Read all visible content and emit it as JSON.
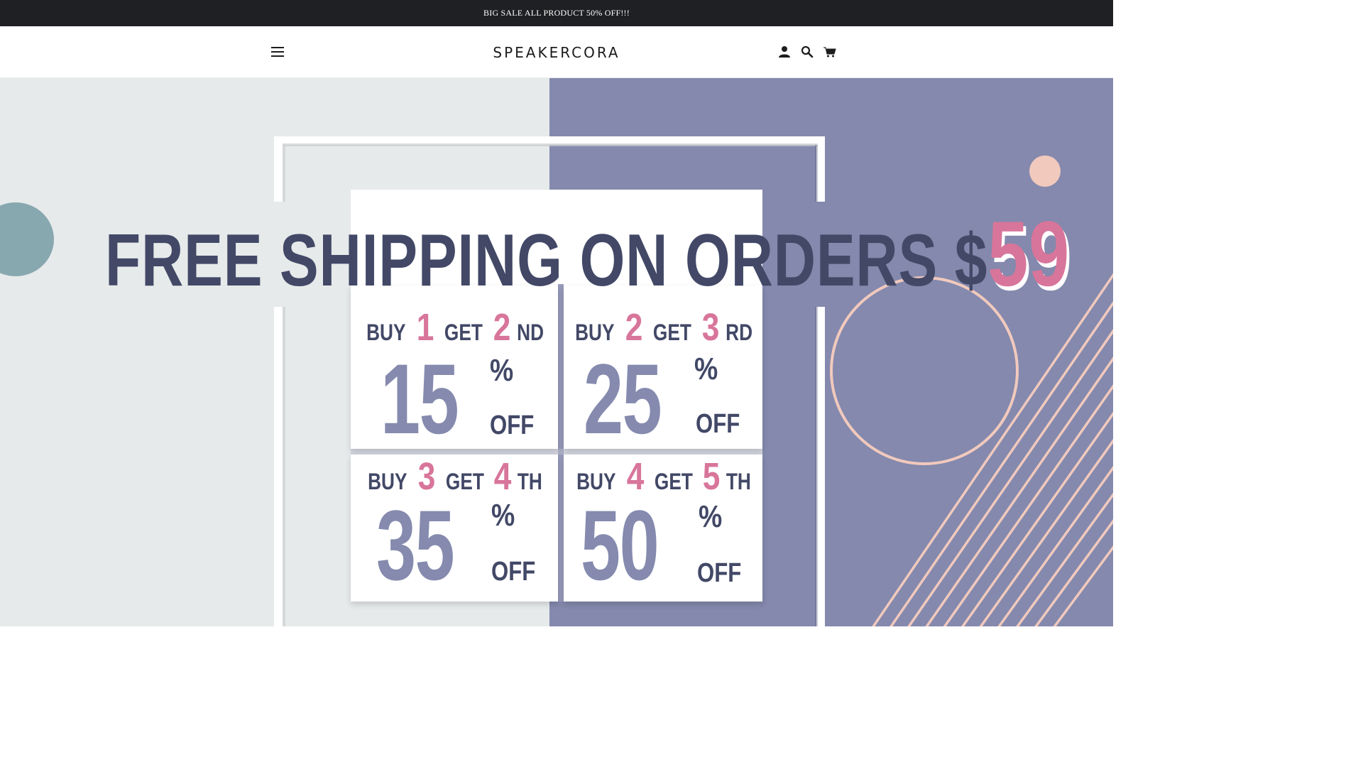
{
  "announcement": {
    "text": "BIG SALE ALL PRODUCT 50% OFF!!!"
  },
  "header": {
    "brand": "SPEAKERCORA",
    "icons": [
      "menu-icon",
      "account-icon",
      "search-icon",
      "cart-icon"
    ]
  },
  "hero": {
    "headline": "FREE SHIPPING ON ORDERS $",
    "headline_amount": "59",
    "colors": {
      "left_bg": "#e6eaea",
      "right_bg": "#8489ad",
      "navy": "#424866",
      "pink": "#d8759a",
      "slate": "#858aae",
      "peach": "#f1c9bd",
      "teal": "#88a8b0"
    },
    "offers": [
      {
        "buy": "BUY",
        "buy_num": "1",
        "get": "GET",
        "get_num": "2",
        "get_suffix": "ND",
        "percent": "15",
        "pct_sign": "%",
        "off": "OFF"
      },
      {
        "buy": "BUY",
        "buy_num": "2",
        "get": "GET",
        "get_num": "3",
        "get_suffix": "RD",
        "percent": "25",
        "pct_sign": "%",
        "off": "OFF"
      },
      {
        "buy": "BUY",
        "buy_num": "3",
        "get": "GET",
        "get_num": "4",
        "get_suffix": "TH",
        "percent": "35",
        "pct_sign": "%",
        "off": "OFF"
      },
      {
        "buy": "BUY",
        "buy_num": "4",
        "get": "GET",
        "get_num": "5",
        "get_suffix": "TH",
        "percent": "50",
        "pct_sign": "%",
        "off": "OFF"
      }
    ]
  }
}
